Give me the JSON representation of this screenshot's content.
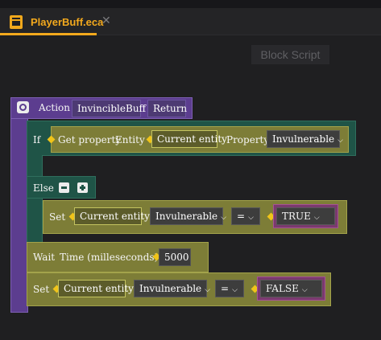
{
  "tab": {
    "title": "PlayerBuff.eca",
    "close": "✕"
  },
  "toolbar": {
    "block_script": "Block Script"
  },
  "action": {
    "label": "Action",
    "name": "InvincibleBuff",
    "return_label": "Return"
  },
  "if_block": {
    "label": "If",
    "get_property": "Get property",
    "entity_label": "Entity",
    "entity_value": "Current entity",
    "property_label": "Property",
    "property_value": "Invulnerable"
  },
  "else_block": {
    "label": "Else"
  },
  "set_block_1": {
    "label": "Set",
    "entity": "Current entity",
    "property": "Invulnerable",
    "op": "=",
    "value": "TRUE"
  },
  "wait_block": {
    "label": "Wait",
    "time_label": "Time (milleseconds)",
    "time_value": "5000"
  },
  "set_block_2": {
    "label": "Set",
    "entity": "Current entity",
    "property": "Invulnerable",
    "op": "=",
    "value": "FALSE"
  },
  "colors": {
    "accent": "#f3a91d",
    "purple": "#5c3d8f",
    "green": "#1f5447",
    "olive": "#7d7d37",
    "magenta": "#7a3a6e"
  }
}
